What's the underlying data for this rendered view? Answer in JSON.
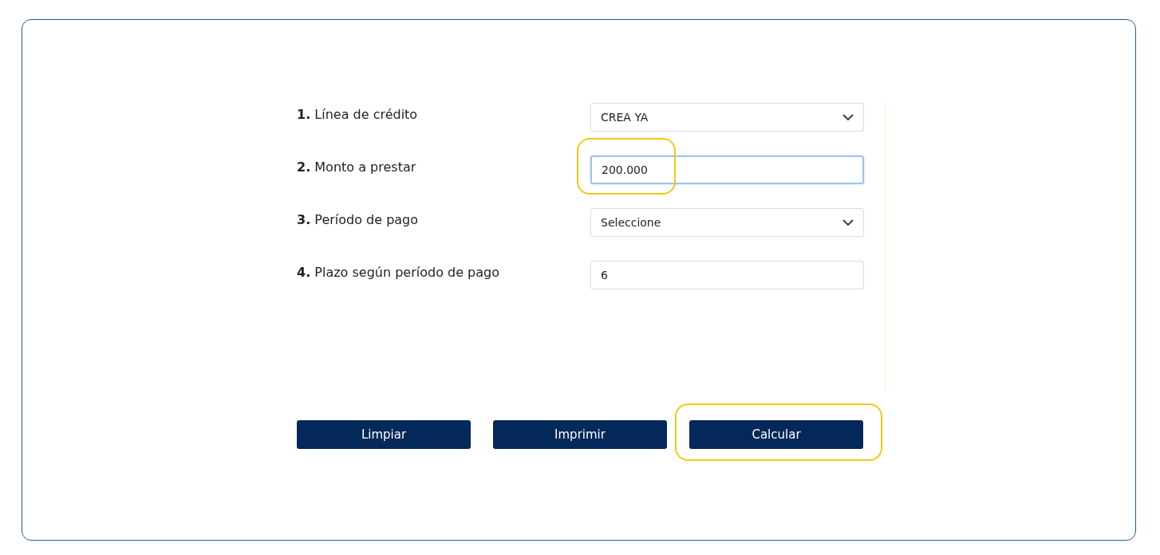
{
  "fields": [
    {
      "label": "**1.** Línea de crédito",
      "kind": "select",
      "value": "CREA YA",
      "focused": false,
      "highlighted": false
    },
    {
      "label": "**2.** Monto a prestar",
      "kind": "input",
      "value": "200.000",
      "focused": true,
      "highlighted": true
    },
    {
      "label": "**3.** Período de pago",
      "kind": "select",
      "value": "Seleccione",
      "focused": false,
      "highlighted": false
    },
    {
      "label": "**4.** Plazo según período de pago",
      "kind": "input",
      "value": "6",
      "focused": false,
      "highlighted": false
    }
  ],
  "buttons": [
    {
      "label": "Limpiar",
      "highlighted": false
    },
    {
      "label": "Imprimir",
      "highlighted": false
    },
    {
      "label": "Calcular",
      "highlighted": true
    }
  ]
}
